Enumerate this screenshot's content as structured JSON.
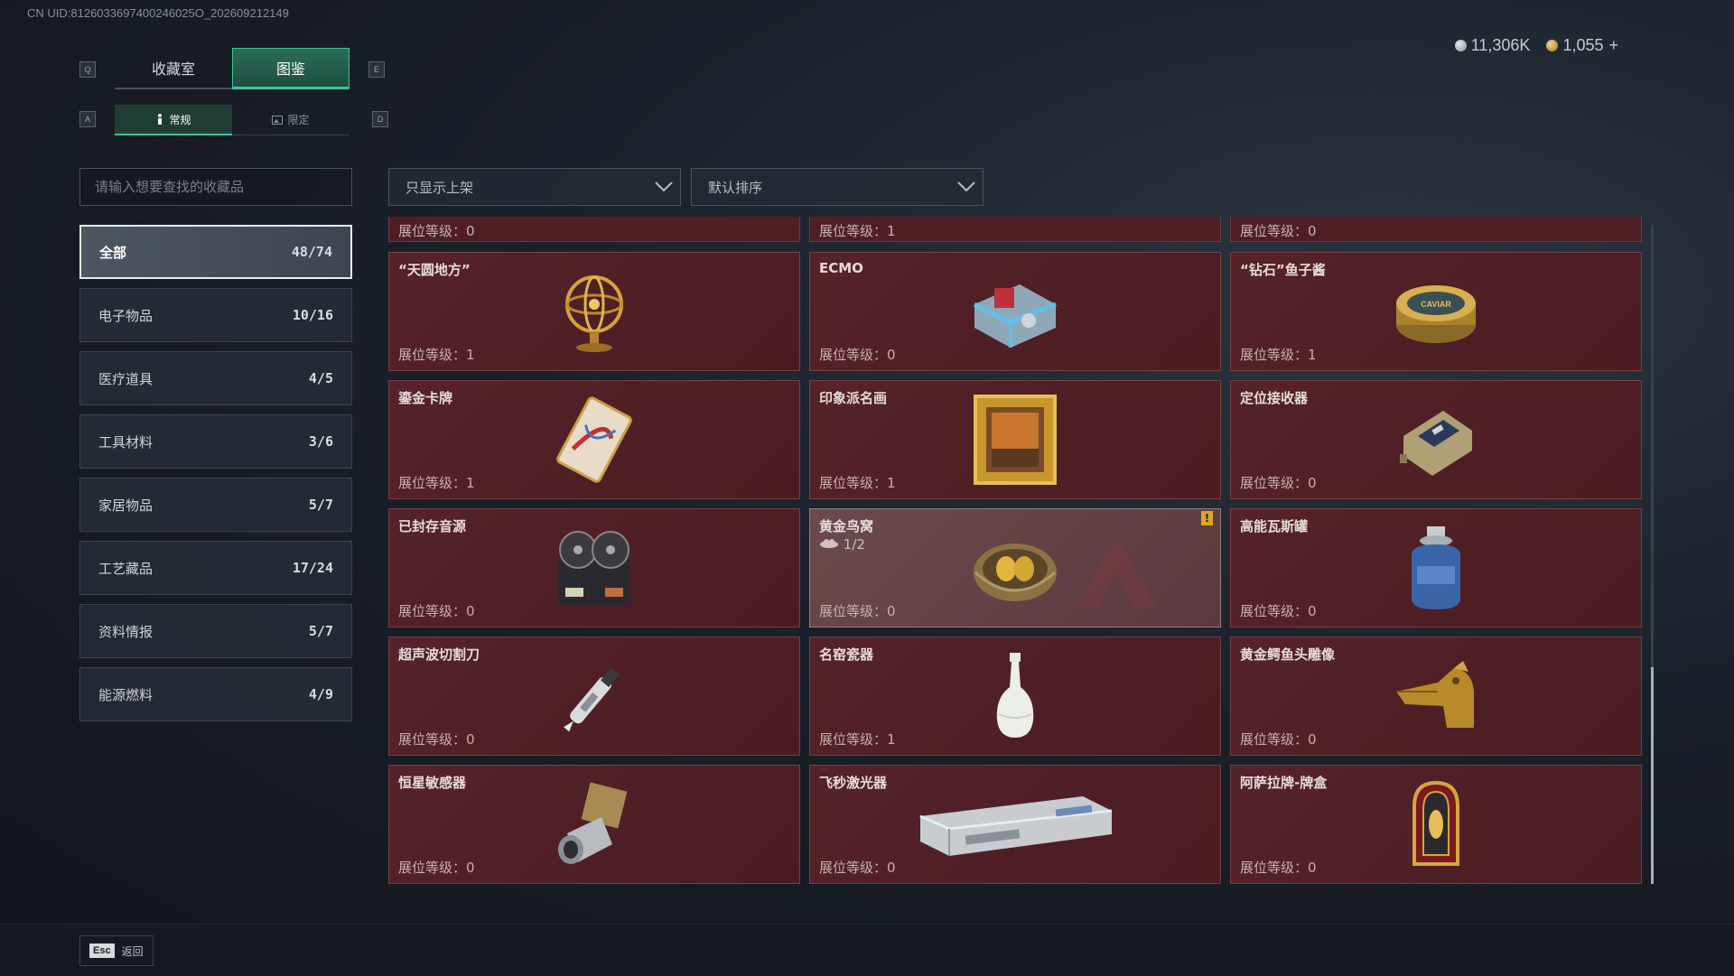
{
  "uid": "CN UID:8126033697400246025O_202609212149",
  "currency": {
    "silver": "11,306K",
    "gold": "1,055",
    "add": "+"
  },
  "hotkeys": {
    "prev_tab": "Q",
    "next_tab": "E",
    "prev_sub": "A",
    "next_sub": "D"
  },
  "tabs": [
    {
      "label": "收藏室"
    },
    {
      "label": "图鉴"
    }
  ],
  "subtabs": [
    {
      "label": "常规"
    },
    {
      "label": "限定"
    }
  ],
  "search": {
    "placeholder": "请输入想要查找的收藏品"
  },
  "categories": [
    {
      "label": "全部",
      "count": "48/74"
    },
    {
      "label": "电子物品",
      "count": "10/16"
    },
    {
      "label": "医疗道具",
      "count": "4/5"
    },
    {
      "label": "工具材料",
      "count": "3/6"
    },
    {
      "label": "家居物品",
      "count": "5/7"
    },
    {
      "label": "工艺藏品",
      "count": "17/24"
    },
    {
      "label": "资料情报",
      "count": "5/7"
    },
    {
      "label": "能源燃料",
      "count": "4/9"
    }
  ],
  "filters": {
    "shelf": "只显示上架",
    "sort": "默认排序"
  },
  "partial_row": [
    "展位等级：0",
    "展位等级：1",
    "展位等级：0"
  ],
  "items": [
    {
      "name": "“天圆地方”",
      "level": "展位等级：1"
    },
    {
      "name": "ECMO",
      "level": "展位等级：0"
    },
    {
      "name": "“钻石”鱼子酱",
      "level": "展位等级：1"
    },
    {
      "name": "鎏金卡牌",
      "level": "展位等级：1"
    },
    {
      "name": "印象派名画",
      "level": "展位等级：1"
    },
    {
      "name": "定位接收器",
      "level": "展位等级：0"
    },
    {
      "name": "已封存音源",
      "level": "展位等级：0"
    },
    {
      "name": "黄金鸟窝",
      "level": "展位等级：0",
      "sub": "1/2",
      "alert": "!"
    },
    {
      "name": "高能瓦斯罐",
      "level": "展位等级：0"
    },
    {
      "name": "超声波切割刀",
      "level": "展位等级：0"
    },
    {
      "name": "名窑瓷器",
      "level": "展位等级：1"
    },
    {
      "name": "黄金鳄鱼头雕像",
      "level": "展位等级：0"
    },
    {
      "name": "恒星敏感器",
      "level": "展位等级：0"
    },
    {
      "name": "飞秒激光器",
      "level": "展位等级：0"
    },
    {
      "name": "阿萨拉牌-牌盒",
      "level": "展位等级：0"
    }
  ],
  "caviar_label": "CAVIAR",
  "footer": {
    "esc": "Esc",
    "back": "返回"
  }
}
